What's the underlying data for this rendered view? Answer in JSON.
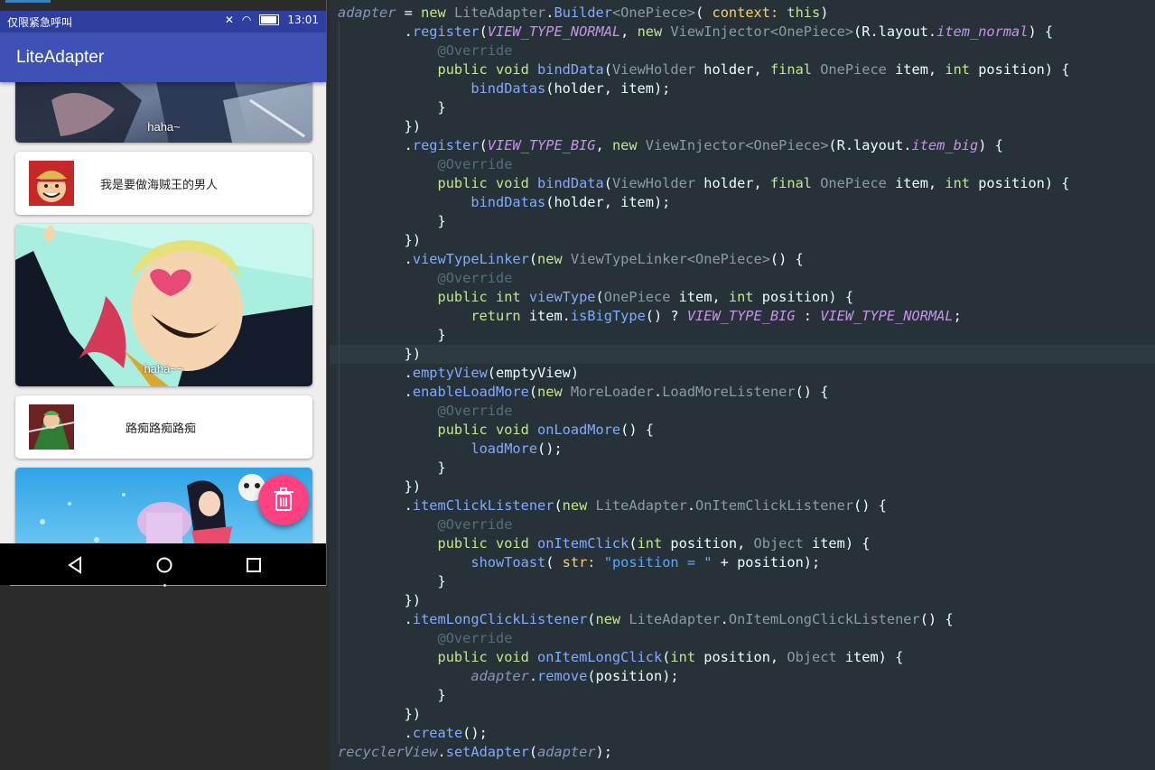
{
  "status_bar": {
    "carrier": "仅限紧急呼叫",
    "time": "13:01"
  },
  "app_bar": {
    "title": "LiteAdapter"
  },
  "list": {
    "items": [
      {
        "type": "big",
        "caption": "haha~"
      },
      {
        "type": "normal",
        "label": "我是要做海贼王的男人"
      },
      {
        "type": "big",
        "caption": "haha~~"
      },
      {
        "type": "normal",
        "label": "路痴路痴路痴"
      },
      {
        "type": "big",
        "caption": ""
      }
    ]
  },
  "fab": {
    "icon": "trash-icon",
    "color": "#ff4081"
  },
  "nav": {
    "back": "back-icon",
    "home": "home-icon",
    "recents": "recents-icon"
  },
  "code": {
    "lines": [
      [
        [
          "v",
          "adapter"
        ],
        [
          "x",
          " = "
        ],
        [
          "k",
          "new "
        ],
        [
          "t",
          "LiteAdapter"
        ],
        [
          "x",
          "."
        ],
        [
          "m",
          "Builder"
        ],
        [
          "t",
          "<OnePiece>"
        ],
        [
          "x",
          "( "
        ],
        [
          "h",
          "context: "
        ],
        [
          "k",
          "this"
        ],
        [
          "x",
          ")"
        ]
      ],
      [
        [
          "x",
          "        ."
        ],
        [
          "m",
          "register"
        ],
        [
          "x",
          "("
        ],
        [
          "c",
          "VIEW_TYPE_NORMAL"
        ],
        [
          "x",
          ", "
        ],
        [
          "k",
          "new "
        ],
        [
          "t",
          "ViewInjector<OnePiece>"
        ],
        [
          "x",
          "(R.layout."
        ],
        [
          "c",
          "item_normal"
        ],
        [
          "x",
          ") {"
        ]
      ],
      [
        [
          "a",
          "            @Override"
        ]
      ],
      [
        [
          "k",
          "            public void "
        ],
        [
          "m",
          "bindData"
        ],
        [
          "x",
          "("
        ],
        [
          "t",
          "ViewHolder "
        ],
        [
          "x",
          "holder, "
        ],
        [
          "k",
          "final "
        ],
        [
          "t",
          "OnePiece "
        ],
        [
          "x",
          "item, "
        ],
        [
          "k",
          "int "
        ],
        [
          "x",
          "position) {"
        ]
      ],
      [
        [
          "x",
          "                "
        ],
        [
          "m",
          "bindDatas"
        ],
        [
          "x",
          "(holder, item);"
        ]
      ],
      [
        [
          "x",
          "            }"
        ]
      ],
      [
        [
          "x",
          "        })"
        ]
      ],
      [
        [
          "x",
          "        ."
        ],
        [
          "m",
          "register"
        ],
        [
          "x",
          "("
        ],
        [
          "c",
          "VIEW_TYPE_BIG"
        ],
        [
          "x",
          ", "
        ],
        [
          "k",
          "new "
        ],
        [
          "t",
          "ViewInjector<OnePiece>"
        ],
        [
          "x",
          "(R.layout."
        ],
        [
          "c",
          "item_big"
        ],
        [
          "x",
          ") {"
        ]
      ],
      [
        [
          "a",
          "            @Override"
        ]
      ],
      [
        [
          "k",
          "            public void "
        ],
        [
          "m",
          "bindData"
        ],
        [
          "x",
          "("
        ],
        [
          "t",
          "ViewHolder "
        ],
        [
          "x",
          "holder, "
        ],
        [
          "k",
          "final "
        ],
        [
          "t",
          "OnePiece "
        ],
        [
          "x",
          "item, "
        ],
        [
          "k",
          "int "
        ],
        [
          "x",
          "position) {"
        ]
      ],
      [
        [
          "x",
          "                "
        ],
        [
          "m",
          "bindDatas"
        ],
        [
          "x",
          "(holder, item);"
        ]
      ],
      [
        [
          "x",
          "            }"
        ]
      ],
      [
        [
          "x",
          "        })"
        ]
      ],
      [
        [
          "x",
          "        ."
        ],
        [
          "m",
          "viewTypeLinker"
        ],
        [
          "x",
          "("
        ],
        [
          "k",
          "new "
        ],
        [
          "t",
          "ViewTypeLinker<OnePiece>"
        ],
        [
          "x",
          "() {"
        ]
      ],
      [
        [
          "a",
          "            @Override"
        ]
      ],
      [
        [
          "k",
          "            public int "
        ],
        [
          "m",
          "viewType"
        ],
        [
          "x",
          "("
        ],
        [
          "t",
          "OnePiece "
        ],
        [
          "x",
          "item, "
        ],
        [
          "k",
          "int "
        ],
        [
          "x",
          "position) {"
        ]
      ],
      [
        [
          "k",
          "                return "
        ],
        [
          "x",
          "item."
        ],
        [
          "m",
          "isBigType"
        ],
        [
          "x",
          "() ? "
        ],
        [
          "c",
          "VIEW_TYPE_BIG"
        ],
        [
          "x",
          " : "
        ],
        [
          "c",
          "VIEW_TYPE_NORMAL"
        ],
        [
          "x",
          ";"
        ]
      ],
      [
        [
          "x",
          "            }"
        ]
      ],
      [
        [
          "x",
          "        })"
        ]
      ],
      [
        [
          "x",
          "        ."
        ],
        [
          "m",
          "emptyView"
        ],
        [
          "x",
          "(emptyView)"
        ]
      ],
      [
        [
          "x",
          "        ."
        ],
        [
          "m",
          "enableLoadMore"
        ],
        [
          "x",
          "("
        ],
        [
          "k",
          "new "
        ],
        [
          "t",
          "MoreLoader"
        ],
        [
          "x",
          "."
        ],
        [
          "t",
          "LoadMoreListener"
        ],
        [
          "x",
          "() {"
        ]
      ],
      [
        [
          "a",
          "            @Override"
        ]
      ],
      [
        [
          "k",
          "            public void "
        ],
        [
          "m",
          "onLoadMore"
        ],
        [
          "x",
          "() {"
        ]
      ],
      [
        [
          "x",
          "                "
        ],
        [
          "m",
          "loadMore"
        ],
        [
          "x",
          "();"
        ]
      ],
      [
        [
          "x",
          "            }"
        ]
      ],
      [
        [
          "x",
          "        })"
        ]
      ],
      [
        [
          "x",
          "        ."
        ],
        [
          "m",
          "itemClickListener"
        ],
        [
          "x",
          "("
        ],
        [
          "k",
          "new "
        ],
        [
          "t",
          "LiteAdapter"
        ],
        [
          "x",
          "."
        ],
        [
          "t",
          "OnItemClickListener"
        ],
        [
          "x",
          "() {"
        ]
      ],
      [
        [
          "a",
          "            @Override"
        ]
      ],
      [
        [
          "k",
          "            public void "
        ],
        [
          "m",
          "onItemClick"
        ],
        [
          "x",
          "("
        ],
        [
          "k",
          "int "
        ],
        [
          "x",
          "position, "
        ],
        [
          "t",
          "Object "
        ],
        [
          "x",
          "item) {"
        ]
      ],
      [
        [
          "x",
          "                "
        ],
        [
          "m",
          "showToast"
        ],
        [
          "x",
          "( "
        ],
        [
          "h",
          "str: "
        ],
        [
          "s",
          "\"position = \""
        ],
        [
          "x",
          " + position);"
        ]
      ],
      [
        [
          "x",
          "            }"
        ]
      ],
      [
        [
          "x",
          "        })"
        ]
      ],
      [
        [
          "x",
          "        ."
        ],
        [
          "m",
          "itemLongClickListener"
        ],
        [
          "x",
          "("
        ],
        [
          "k",
          "new "
        ],
        [
          "t",
          "LiteAdapter"
        ],
        [
          "x",
          "."
        ],
        [
          "t",
          "OnItemLongClickListener"
        ],
        [
          "x",
          "() {"
        ]
      ],
      [
        [
          "a",
          "            @Override"
        ]
      ],
      [
        [
          "k",
          "            public void "
        ],
        [
          "m",
          "onItemLongClick"
        ],
        [
          "x",
          "("
        ],
        [
          "k",
          "int "
        ],
        [
          "x",
          "position, "
        ],
        [
          "t",
          "Object "
        ],
        [
          "x",
          "item) {"
        ]
      ],
      [
        [
          "x",
          "                "
        ],
        [
          "v",
          "adapter"
        ],
        [
          "x",
          "."
        ],
        [
          "m",
          "remove"
        ],
        [
          "x",
          "(position);"
        ]
      ],
      [
        [
          "x",
          "            }"
        ]
      ],
      [
        [
          "x",
          "        })"
        ]
      ],
      [
        [
          "x",
          "        ."
        ],
        [
          "m",
          "create"
        ],
        [
          "x",
          "();"
        ]
      ],
      [
        [
          "v",
          "recyclerView"
        ],
        [
          "x",
          "."
        ],
        [
          "m",
          "setAdapter"
        ],
        [
          "x",
          "("
        ],
        [
          "v",
          "adapter"
        ],
        [
          "x",
          ");"
        ]
      ]
    ]
  }
}
